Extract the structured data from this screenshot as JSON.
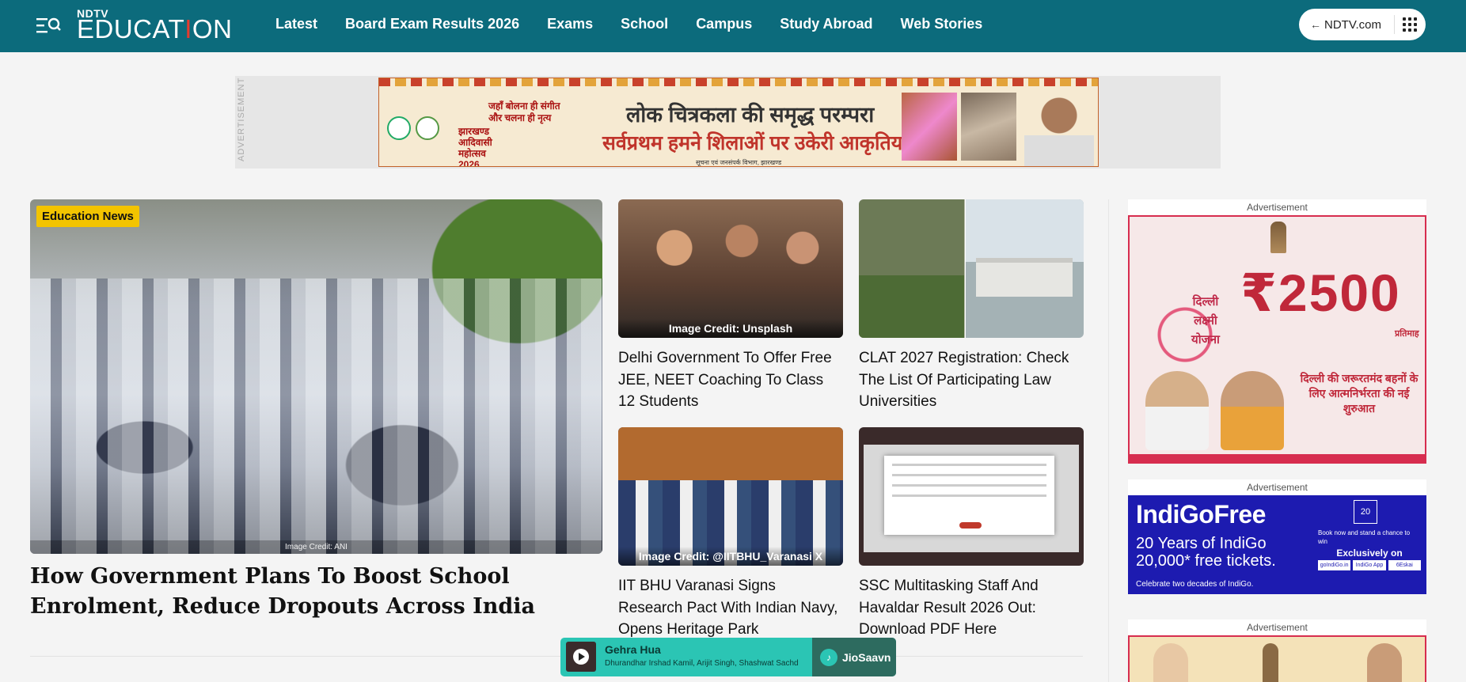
{
  "header": {
    "logo_top": "NDTV",
    "logo_main_pre": "EDUCAT",
    "logo_main_dot": "I",
    "logo_main_post": "ON",
    "nav": [
      "Latest",
      "Board Exam Results 2026",
      "Exams",
      "School",
      "Campus",
      "Study Abroad",
      "Web Stories"
    ],
    "ndtv_link": "NDTV.com",
    "menu_icon": "menu-search-icon",
    "back_icon": "arrow-left-icon",
    "apps_icon": "apps-grid-icon"
  },
  "top_ad": {
    "label": "ADVERTISEMENT",
    "small_text": "जहाँ बोलना ही संगीत\nऔर चलना ही नृत्य",
    "fest_name": "झारखण्ड\nआदिवासी\nमहोत्सव\n2026",
    "headline1": "लोक चित्रकला की समृद्ध परम्परा",
    "headline2": "सर्वप्रथम हमने शिलाओं पर उकेरी आकृतियां",
    "footer": "सूचना एवं जनसंपर्क विभाग, झारखण्ड"
  },
  "feature": {
    "tag": "Education News",
    "credit": "Image Credit: ANI",
    "title": "How Government Plans To Boost School Enrolment, Reduce Dropouts Across India"
  },
  "cards": [
    {
      "credit": "Image Credit: Unsplash",
      "title": "Delhi Government To Offer Free JEE, NEET Coaching To Class 12 Students"
    },
    {
      "credit": "",
      "title": "CLAT 2027 Registration: Check The List Of Participating Law Universities"
    },
    {
      "credit": "Image Credit: @IITBHU_Varanasi X",
      "title": "IIT BHU Varanasi Signs Research Pact With Indian Navy, Opens Heritage Park"
    },
    {
      "credit": "",
      "title": "SSC Multitasking Staff And Havaldar Result 2026 Out: Download PDF Here"
    }
  ],
  "right_ads": {
    "label": "Advertisement",
    "ad1": {
      "scheme": "दिल्ली\nलक्ष्मी\nयोजना",
      "amount": "₹2500",
      "per_month": "प्रतिमाह",
      "tagline": "दिल्ली की जरूरतमंद बहनों के लिए आत्मनिर्भरता की नई शुरुआत"
    },
    "ad2": {
      "title": "IndiGoFree",
      "subtitle": "20 Years of IndiGo\n20,000* free tickets.",
      "side": "Book now and stand a chance to win",
      "exclusive": "Exclusively on",
      "chips": [
        "goIndiGo.in",
        "IndiGo App",
        "6Eskai"
      ],
      "footer": "Celebrate two decades of IndiGo.",
      "badge": "20"
    }
  },
  "player": {
    "song": "Gehra Hua",
    "artists": "Dhurandhar     Irshad Kamil, Arijit Singh, Shashwat Sachdev",
    "brand": "JioSaavn",
    "play_icon": "play-icon"
  },
  "colors": {
    "header_bg": "#0c6b7c",
    "tag_bg": "#f3c400",
    "player_bg": "#2bc5b4",
    "indigo_bg": "#1d1bb0"
  }
}
